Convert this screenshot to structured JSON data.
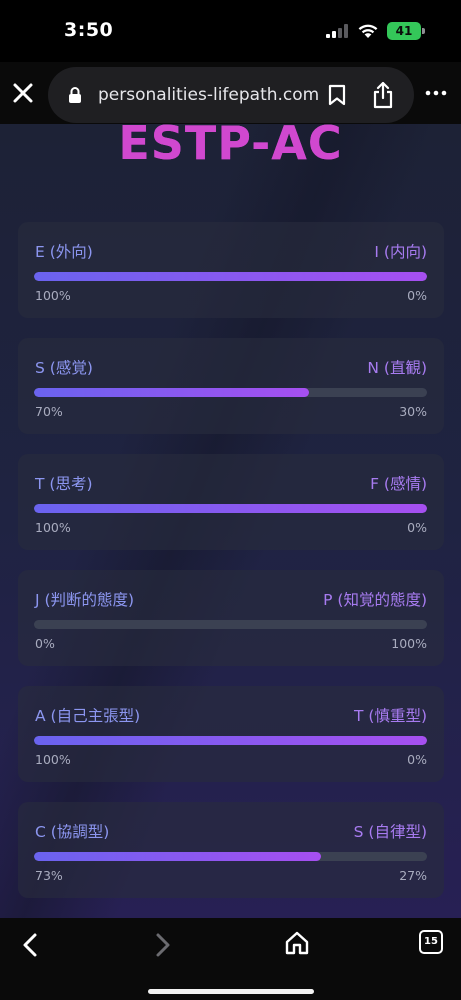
{
  "status_bar": {
    "time": "3:50",
    "battery_level": "41",
    "battery_color": "#34c759"
  },
  "browser": {
    "url": "personalities-lifepath.com"
  },
  "page": {
    "title": "ESTP-AC",
    "title_color": "#d048cf",
    "cards": [
      {
        "left_label": "E (外向)",
        "right_label": "I (内向)",
        "left_percent": "100%",
        "right_percent": "0%",
        "fill_fraction": 1.0
      },
      {
        "left_label": "S (感覚)",
        "right_label": "N (直観)",
        "left_percent": "70%",
        "right_percent": "30%",
        "fill_fraction": 0.7
      },
      {
        "left_label": "T (思考)",
        "right_label": "F (感情)",
        "left_percent": "100%",
        "right_percent": "0%",
        "fill_fraction": 1.0
      },
      {
        "left_label": "J (判断的態度)",
        "right_label": "P (知覚的態度)",
        "left_percent": "0%",
        "right_percent": "100%",
        "fill_fraction": 0.0
      },
      {
        "left_label": "A (自己主張型)",
        "right_label": "T (慎重型)",
        "left_percent": "100%",
        "right_percent": "0%",
        "fill_fraction": 1.0
      },
      {
        "left_label": "C (協調型)",
        "right_label": "S (自律型)",
        "left_percent": "73%",
        "right_percent": "27%",
        "fill_fraction": 0.73
      }
    ]
  },
  "toolbar": {
    "tab_count": "15"
  },
  "icons": {
    "close": "close-icon",
    "lock": "lock-icon",
    "bookmark": "bookmark-icon",
    "share": "share-icon",
    "more": "more-icon",
    "back": "chevron-left-icon",
    "forward": "chevron-right-icon",
    "home": "home-icon",
    "tabs": "tabs-icon",
    "signal": "signal-icon",
    "wifi": "wifi-icon",
    "battery": "battery-icon"
  }
}
